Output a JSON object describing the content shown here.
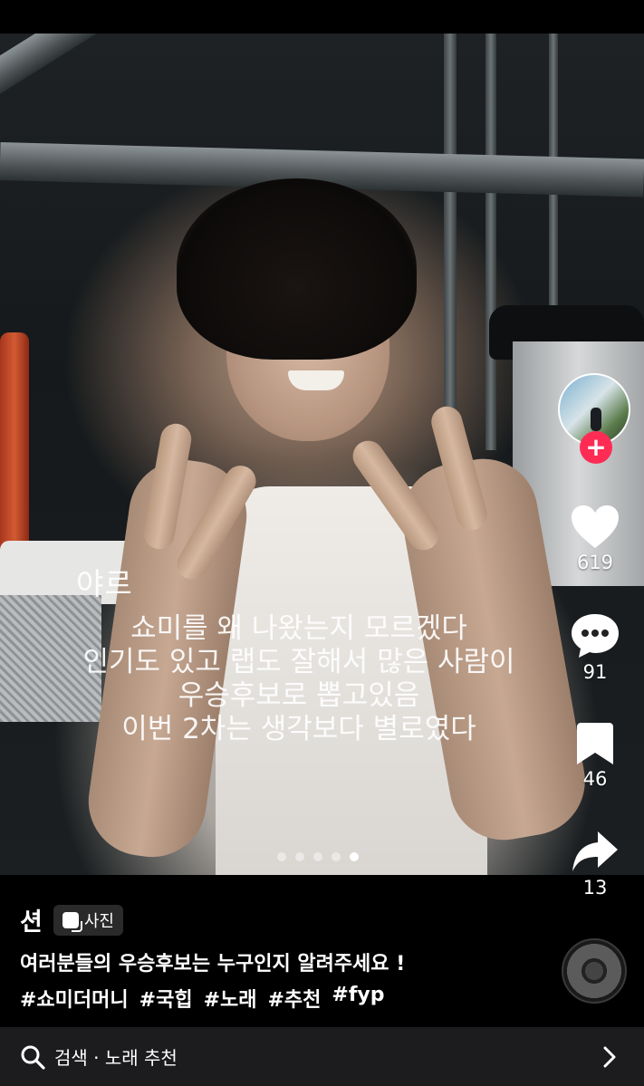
{
  "post": {
    "overlay_nickname": "야르",
    "overlay_lines": [
      "쇼미를 왜 나왔는지 모르겠다",
      "인기도 있고 랩도 잘해서 많은 사람이",
      "우승후보로 뽑고있음",
      "이번 2차는 생각보다 별로였다"
    ],
    "pagination": {
      "total": 5,
      "active_index": 4
    }
  },
  "rail": {
    "likes": "619",
    "comments": "91",
    "saves": "46",
    "shares": "13",
    "follow_symbol": "+"
  },
  "info": {
    "author": "션",
    "badge": "사진",
    "caption": "여러분들의 우승후보는 누구인지 알려주세요 !",
    "hashtags": [
      "#쇼미더머니",
      "#국힙",
      "#노래",
      "#추천",
      "#fyp"
    ]
  },
  "search": {
    "text": "검색 · 노래 추천"
  },
  "colors": {
    "follow_accent": "#fe2c55",
    "background": "#000000",
    "search_bar": "#1c1c1e"
  },
  "icons": [
    "heart-icon",
    "comment-icon",
    "bookmark-icon",
    "share-icon",
    "search-icon",
    "chevron-right-icon",
    "photo-icon"
  ]
}
